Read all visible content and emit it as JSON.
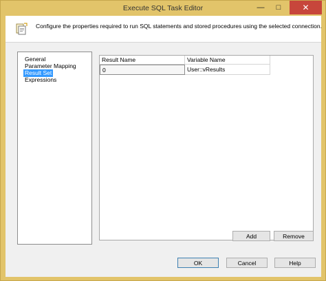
{
  "window": {
    "title": "Execute SQL Task Editor",
    "minimize_glyph": "—",
    "maximize_glyph": "□",
    "close_glyph": "✕",
    "accent_color": "#e2c46a",
    "close_color": "#c7463b"
  },
  "header": {
    "icon": "task-editor-icon",
    "description": "Configure the properties required to run SQL statements and stored procedures using the selected connection."
  },
  "nav": {
    "items": [
      {
        "label": "General",
        "selected": false
      },
      {
        "label": "Parameter Mapping",
        "selected": false
      },
      {
        "label": "Result Set",
        "selected": true
      },
      {
        "label": "Expressions",
        "selected": false
      }
    ],
    "selected_color": "#3399ff"
  },
  "result_grid": {
    "columns": [
      "Result Name",
      "Variable Name"
    ],
    "rows": [
      [
        "0",
        "User::vResults"
      ]
    ]
  },
  "grid_buttons": {
    "add": "Add",
    "remove": "Remove"
  },
  "dialog_buttons": {
    "ok": "OK",
    "cancel": "Cancel",
    "help": "Help"
  }
}
